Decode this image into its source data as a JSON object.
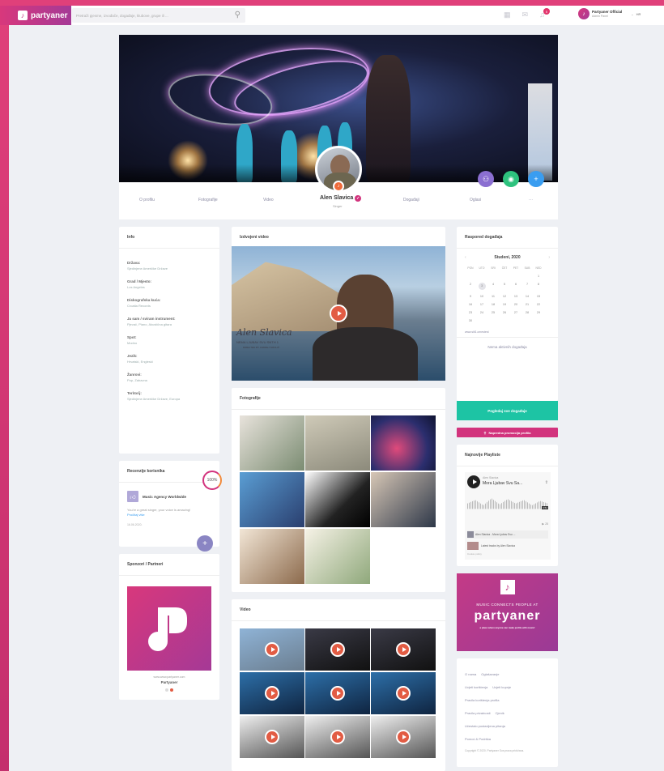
{
  "topbar": {
    "logo_text": "partyaner",
    "search_placeholder": "Pretraži pjesme, izvođače, događaje, klubove, grupe ili ...",
    "notif_count": "5",
    "user_name": "Partyaner Official",
    "user_sub": "Admin Panel",
    "lang": "HR"
  },
  "profile": {
    "name": "Alen Slavica",
    "subtitle": "Singer",
    "nav": [
      "O profilu",
      "Fotografije",
      "Video",
      "Događaji",
      "Oglasi",
      "···"
    ]
  },
  "info": {
    "title": "Info",
    "items": [
      {
        "k": "Država:",
        "v": "Sjedinjene Američke Države"
      },
      {
        "k": "Grad / Mjesto:",
        "v": "Los Angeles"
      },
      {
        "k": "Diskografska kuća:",
        "v": "Croatia Records"
      },
      {
        "k": "Ja sam / sviram instrument:",
        "v": "Pjevač, Piano, Akustična gitara"
      },
      {
        "k": "Spot:",
        "v": "Modno"
      },
      {
        "k": "Jezik:",
        "v": "Hrvatski, Engleski"
      },
      {
        "k": "Žanrovi:",
        "v": "Pop, Zabavna"
      },
      {
        "k": "Teritorij:",
        "v": "Sjedinjene Američke Države, Europa"
      }
    ]
  },
  "reviews": {
    "title": "Recenzije korisnika",
    "percent": "100%",
    "author": "Music Agency Worldwide",
    "text": "You're a great singer, your voice is amazing!",
    "link": "Pročitaj više",
    "date": "16.06.2020."
  },
  "sponsors": {
    "title": "Sponzori / Partneri",
    "url": "www.www.partyaner.com",
    "name": "Partyaner"
  },
  "featured_video": {
    "title": "Izdvojeni video",
    "overlay_title": "Alen Slavica",
    "overlay_sub": "NEMA LJUBAV SVU SNTH 1",
    "overlay_credit": "DIRECTED BY ANDREJ SMOLIČ"
  },
  "photos": {
    "title": "Fotografije"
  },
  "videos": {
    "title": "Video"
  },
  "calendar": {
    "title": "Raspored događaja",
    "month": "Studeni, 2020",
    "weekdays": [
      "PON",
      "UTO",
      "SRI",
      "ČET",
      "PET",
      "SUB",
      "NED"
    ],
    "weeks": [
      [
        "",
        "",
        "",
        "",
        "",
        "",
        "1"
      ],
      [
        "2",
        "3",
        "4",
        "5",
        "6",
        "7",
        "8"
      ],
      [
        "9",
        "10",
        "11",
        "12",
        "13",
        "14",
        "15"
      ],
      [
        "16",
        "17",
        "18",
        "19",
        "20",
        "21",
        "22"
      ],
      [
        "23",
        "24",
        "25",
        "26",
        "27",
        "28",
        "29"
      ],
      [
        "30",
        "",
        "",
        "",
        "",
        "",
        ""
      ]
    ],
    "link": "www.siti1.cmestest",
    "empty": "Nema aktivnih događaja",
    "btn_all": "Pogledaj sve događaje",
    "btn_promo": "Napredna promocija profila"
  },
  "playlists": {
    "title": "Najnovije Playliste",
    "artist": "Alen Slavica",
    "track": "Mora Ljubav Svu Sa...",
    "duration": "3:51",
    "plays": "28",
    "item": "Alen Slavica - Mora Ljubav Svu ...",
    "latest": "Latest tracks by Alen Slavica",
    "cookie": "Cookie policy"
  },
  "banner": {
    "tagline": "MUSIC CONNECTS PEOPLE AT",
    "brand": "partyaner",
    "cta": "a place where anyone can make profile with music!"
  },
  "footer": {
    "links": [
      "O nama",
      "Oglašavanje",
      "Uvjeti korištenja",
      "Uvjeti kupnje",
      "Pravila korištenja profila",
      "Pravila privatnosti",
      "Cjenik",
      "Učestalo postavljena pitanja",
      "Pomoć & Podrška"
    ],
    "copyright": "Copyright © 2020. Partyaner Sva prava pridržana."
  },
  "colors": {
    "brand": "#d2337d",
    "teal": "#1dc4a4",
    "accent": "#e25c44"
  }
}
